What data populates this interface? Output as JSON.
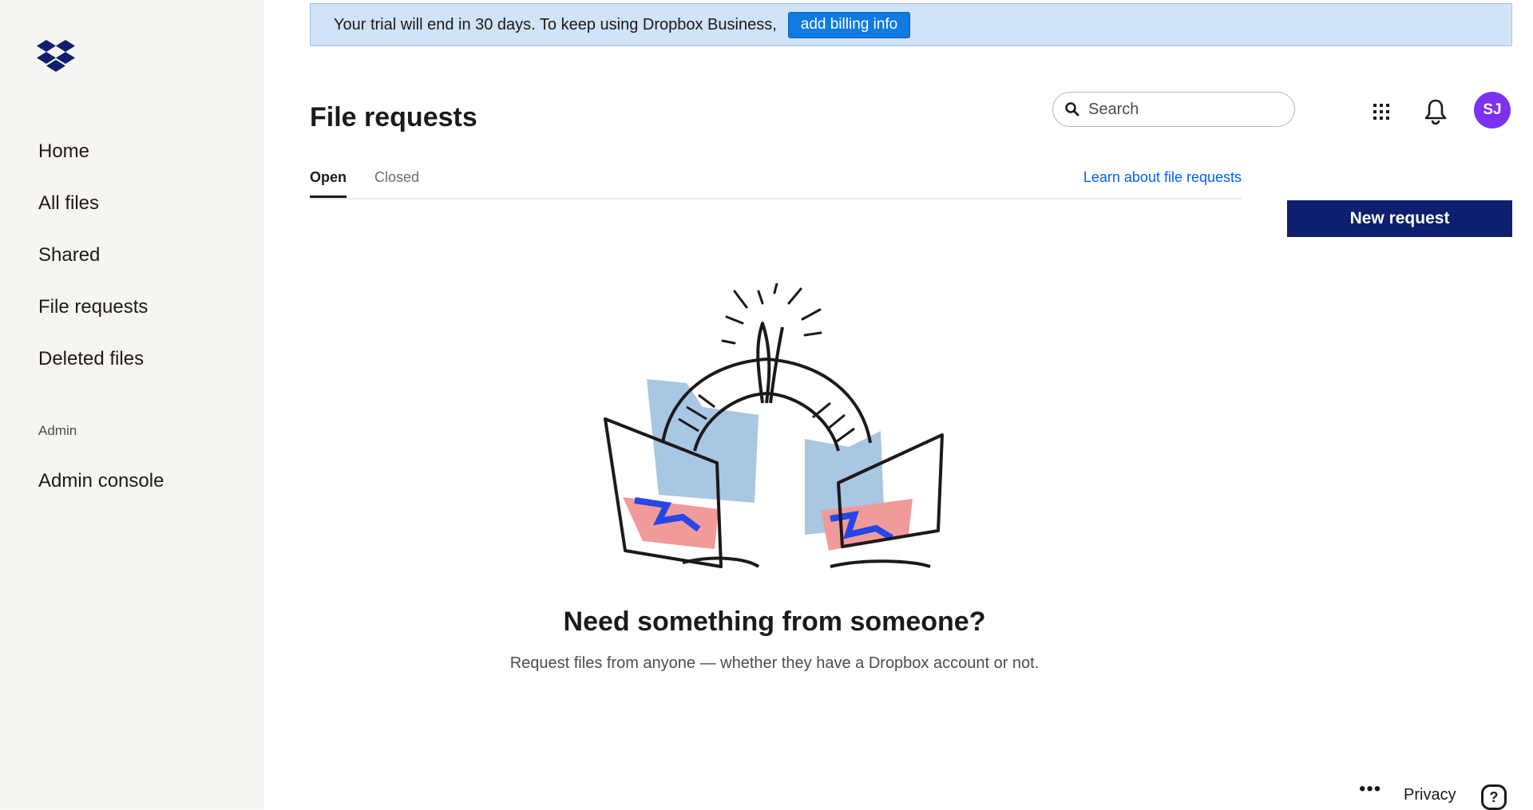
{
  "sidebar": {
    "logo": "Dropbox",
    "items": [
      {
        "label": "Home"
      },
      {
        "label": "All files"
      },
      {
        "label": "Shared"
      },
      {
        "label": "File requests"
      },
      {
        "label": "Deleted files"
      }
    ],
    "admin_label": "Admin",
    "admin_console": "Admin console"
  },
  "banner": {
    "text": "Your trial will end in 30 days. To keep using Dropbox Business,",
    "button": "add billing info"
  },
  "header": {
    "title": "File requests",
    "search_placeholder": "Search",
    "avatar_initials": "SJ",
    "avatar_color": "#7d31f0"
  },
  "tabs": [
    {
      "label": "Open",
      "active": true
    },
    {
      "label": "Closed",
      "active": false
    }
  ],
  "learn_link": "Learn about file requests",
  "new_request": "New request",
  "empty": {
    "heading": "Need something from someone?",
    "text": "Request files from anyone — whether they have a Dropbox account or not."
  },
  "footer": {
    "more": "•••",
    "privacy": "Privacy",
    "help": "?"
  }
}
